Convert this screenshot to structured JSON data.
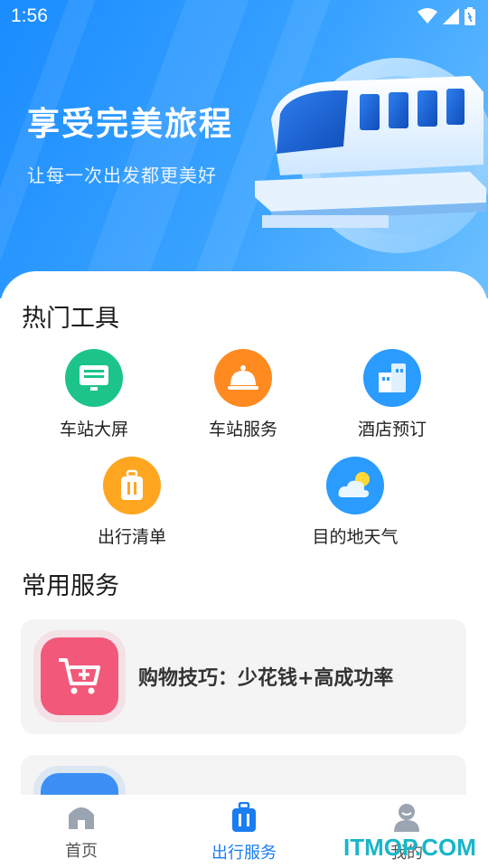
{
  "status_bar": {
    "time": "1:56"
  },
  "hero": {
    "title": "享受完美旅程",
    "subtitle": "让每一次出发都更美好"
  },
  "hot_tools": {
    "title": "热门工具",
    "items": [
      {
        "label": "车站大屏",
        "icon": "screen-icon",
        "color": "#1cc48a"
      },
      {
        "label": "车站服务",
        "icon": "service-bell-icon",
        "color": "#ff8a1f"
      },
      {
        "label": "酒店预订",
        "icon": "hotel-icon",
        "color": "#2a9bff"
      },
      {
        "label": "出行清单",
        "icon": "luggage-icon",
        "color": "#ffa621"
      },
      {
        "label": "目的地天气",
        "icon": "weather-icon",
        "color": "#2a9bff"
      }
    ]
  },
  "common_services": {
    "title": "常用服务",
    "cards": [
      {
        "label": "购物技巧：少花钱+高成功率",
        "icon": "shopping-cart-icon",
        "color": "#f2587a"
      },
      {
        "label": "",
        "icon": "blue-card-icon",
        "color": "#3d8ff5"
      }
    ]
  },
  "tabbar": {
    "tabs": [
      {
        "label": "首页",
        "icon": "home-icon",
        "active": false
      },
      {
        "label": "出行服务",
        "icon": "luggage-icon",
        "active": true
      },
      {
        "label": "我的",
        "icon": "user-icon",
        "active": false
      }
    ],
    "active_color": "#1a7df0",
    "inactive_color": "#9aa5b1"
  },
  "watermark": "ITMOP.COM"
}
